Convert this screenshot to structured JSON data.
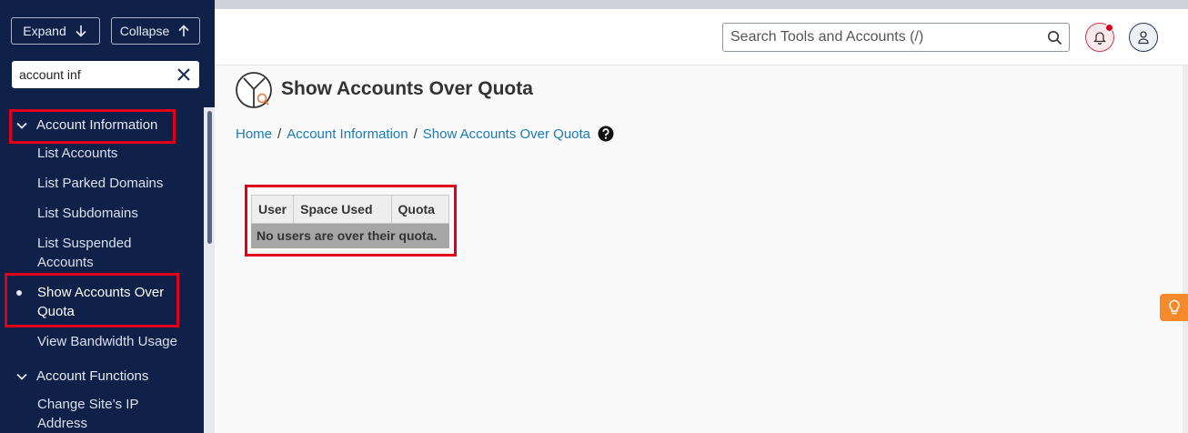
{
  "sidebar": {
    "expand_label": "Expand",
    "collapse_label": "Collapse",
    "search_value": "account inf",
    "categories": [
      {
        "label": "Account Information",
        "items": [
          {
            "label": "List Accounts"
          },
          {
            "label": "List Parked Domains"
          },
          {
            "label": "List Subdomains"
          },
          {
            "label": "List Suspended Accounts"
          },
          {
            "label": "Show Accounts Over Quota",
            "active": true
          },
          {
            "label": "View Bandwidth Usage"
          }
        ]
      },
      {
        "label": "Account Functions",
        "items": [
          {
            "label": "Change Site’s IP Address"
          }
        ]
      }
    ]
  },
  "header": {
    "search_placeholder": "Search Tools and Accounts (/)"
  },
  "main": {
    "title": "Show Accounts Over Quota",
    "breadcrumb": [
      "Home",
      "Account Information",
      "Show Accounts Over Quota"
    ],
    "breadcrumb_separator": "/",
    "table": {
      "columns": [
        "User",
        "Space Used",
        "Quota"
      ],
      "empty_message": "No users are over their quota."
    }
  },
  "colors": {
    "sidebar_bg": "#0f2148",
    "highlight": "#e0001a",
    "link": "#1b7ab8",
    "notification": "#d9001b",
    "tip_button": "#f58a2c"
  },
  "icons": [
    "arrow-down-icon",
    "arrow-up-icon",
    "close-icon",
    "chevron-down-icon",
    "search-icon",
    "bell-icon",
    "user-icon",
    "page-icon",
    "help-icon",
    "lightbulb-icon"
  ]
}
